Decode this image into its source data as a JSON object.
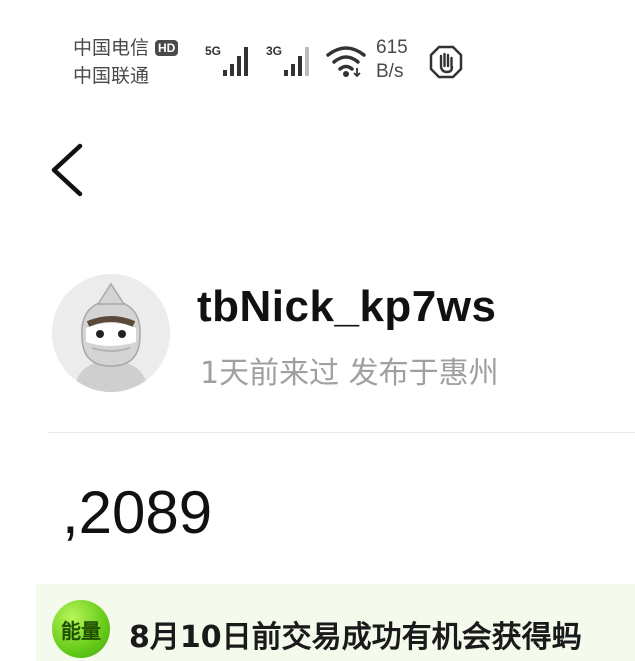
{
  "status_bar": {
    "carrier_1": "中国电信",
    "hd_badge": "HD",
    "carrier_2": "中国联通",
    "signal_1_label": "5G",
    "signal_2_label": "3G",
    "speed_value": "615",
    "speed_unit": "B/s",
    "icons": [
      "signal-5g-icon",
      "signal-3g-icon",
      "wifi-icon",
      "hand-stop-icon"
    ]
  },
  "nav": {
    "back_icon": "chevron-left-icon"
  },
  "profile": {
    "username": "tbNick_kp7ws",
    "meta": "1天前来过 发布于惠州"
  },
  "listing": {
    "price": ",2089"
  },
  "promo": {
    "badge": "能量",
    "text": "8月10日前交易成功有机会获得蚂"
  },
  "colors": {
    "promo_background": "#f4faec",
    "badge_green": "#6ccf1d",
    "meta_gray": "#a0a0a0"
  }
}
